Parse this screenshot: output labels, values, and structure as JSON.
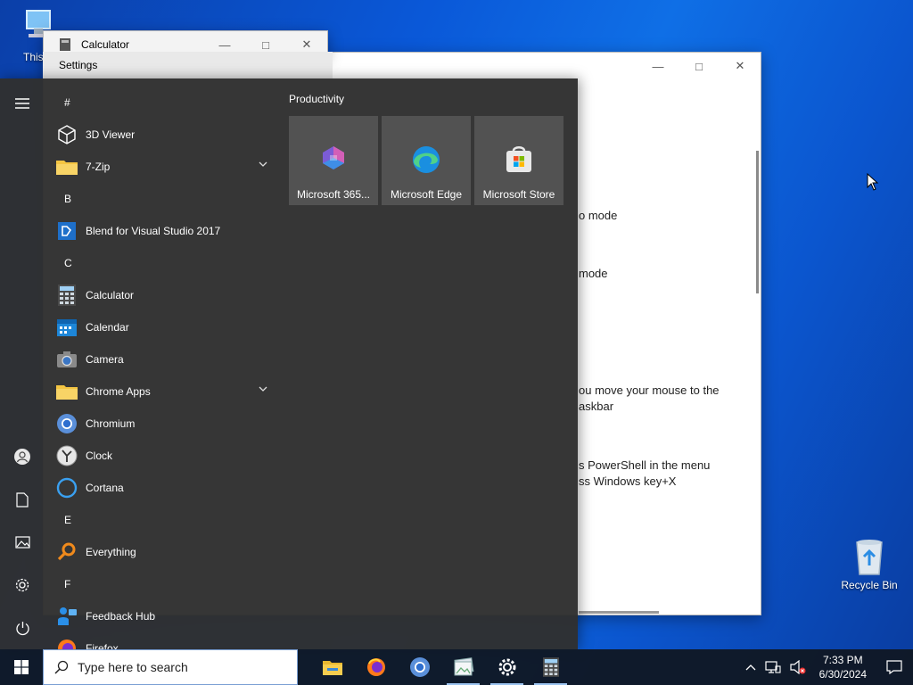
{
  "desktop": {
    "this_pc_label": "This P",
    "recycle_bin_label": "Recycle Bin"
  },
  "calculator_window": {
    "title": "Calculator"
  },
  "settings_window": {
    "title": "Settings",
    "snippets": [
      "o mode",
      "mode",
      "ou move your mouse to the",
      "askbar",
      "s PowerShell in the menu",
      "ss Windows key+X"
    ]
  },
  "start_menu": {
    "groups": [
      {
        "letter": "#",
        "apps": [
          {
            "label": "3D Viewer",
            "icon": "cube-icon"
          },
          {
            "label": "7-Zip",
            "icon": "folder-icon",
            "expandable": true
          }
        ]
      },
      {
        "letter": "B",
        "apps": [
          {
            "label": "Blend for Visual Studio 2017",
            "icon": "blend-icon"
          }
        ]
      },
      {
        "letter": "C",
        "apps": [
          {
            "label": "Calculator",
            "icon": "calculator-icon"
          },
          {
            "label": "Calendar",
            "icon": "calendar-icon"
          },
          {
            "label": "Camera",
            "icon": "camera-icon"
          },
          {
            "label": "Chrome Apps",
            "icon": "folder-icon",
            "expandable": true
          },
          {
            "label": "Chromium",
            "icon": "chromium-icon"
          },
          {
            "label": "Clock",
            "icon": "clock-icon"
          },
          {
            "label": "Cortana",
            "icon": "cortana-icon"
          }
        ]
      },
      {
        "letter": "E",
        "apps": [
          {
            "label": "Everything",
            "icon": "search-magnifier-icon"
          }
        ]
      },
      {
        "letter": "F",
        "apps": [
          {
            "label": "Feedback Hub",
            "icon": "feedback-icon"
          },
          {
            "label": "Firefox",
            "icon": "firefox-icon"
          }
        ]
      }
    ],
    "tile_group_title": "Productivity",
    "tiles": [
      {
        "label": "Microsoft 365...",
        "icon": "microsoft-365-icon"
      },
      {
        "label": "Microsoft Edge",
        "icon": "edge-icon"
      },
      {
        "label": "Microsoft Store",
        "icon": "store-icon"
      }
    ]
  },
  "taskbar": {
    "search_placeholder": "Type here to search",
    "pinned": [
      "file-explorer-icon",
      "firefox-icon",
      "chromium-icon",
      "photos-icon",
      "settings-gear-icon",
      "calculator-icon"
    ],
    "time": "7:33 PM",
    "date": "6/30/2024"
  },
  "colors": {
    "accent": "#0a58d8",
    "start_bg": "#303030",
    "tile_bg": "#525252"
  }
}
